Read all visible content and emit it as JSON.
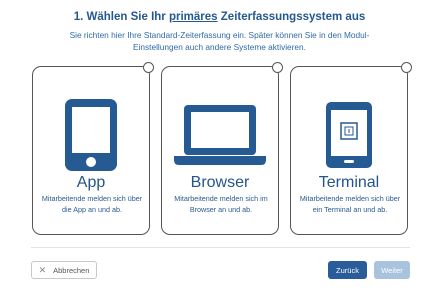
{
  "header": {
    "heading_prefix": "1. Wählen Sie Ihr",
    "heading_highlight": "primäres",
    "heading_suffix": "Zeiterfassungssystem aus",
    "subtext": "Sie richten hier Ihre Standard-Zeiterfassung ein. Später können Sie in den Modul-Einstellungen auch andere Systeme aktivieren."
  },
  "options": [
    {
      "title": "App",
      "icon": "smartphone-icon",
      "description": "Mitarbeitende melden sich über die App an und ab."
    },
    {
      "title": "Browser",
      "icon": "laptop-icon",
      "description": "Mitarbeitende melden sich im Browser an und ab."
    },
    {
      "title": "Terminal",
      "icon": "terminal-tablet-icon",
      "description": "Mitarbeitende melden sich über ein Terminal an und ab."
    }
  ],
  "footer": {
    "cancel_label": "Abbrechen",
    "back_label": "Zurück",
    "next_label": "Weiter"
  },
  "colors": {
    "primary": "#2a5c99",
    "disabled": "#a9c3df",
    "icon": "#255a92"
  }
}
